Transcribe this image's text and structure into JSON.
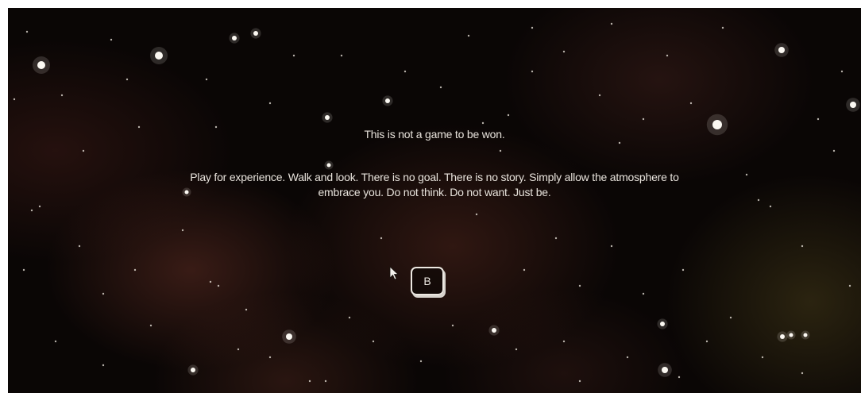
{
  "message": {
    "title": "This is not a game to be won.",
    "body_line1": "Play for experience. Walk and look. There is no goal. There is no story. Simply allow the atmosphere to",
    "body_line2": "embrace you. Do not think. Do not want. Just be."
  },
  "key_prompt": {
    "key": "B"
  },
  "colors": {
    "background": "#0a0605",
    "text": "#e8e3dc",
    "nebula": "#5f2d23"
  }
}
